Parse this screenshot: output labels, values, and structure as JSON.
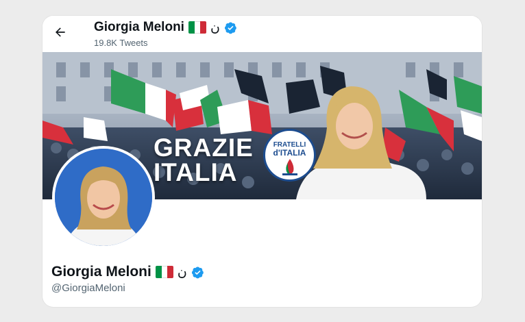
{
  "header": {
    "display_name": "Giorgia Meloni",
    "tweet_count": "19.8K Tweets",
    "back_icon": "arrow-left-icon",
    "nun_glyph": "ن"
  },
  "banner": {
    "headline_line1": "GRAZIE",
    "headline_line2": "ITALIA",
    "logo_line1": "FRATELLI",
    "logo_line2": "d'ITALIA"
  },
  "profile": {
    "display_name": "Giorgia Meloni",
    "handle": "@GiorgiaMeloni",
    "nun_glyph": "ن"
  },
  "colors": {
    "verified": "#1d9bf0",
    "flag_green": "#009246",
    "flag_white": "#ffffff",
    "flag_red": "#ce2b37",
    "party_blue": "#1c4c8f"
  }
}
